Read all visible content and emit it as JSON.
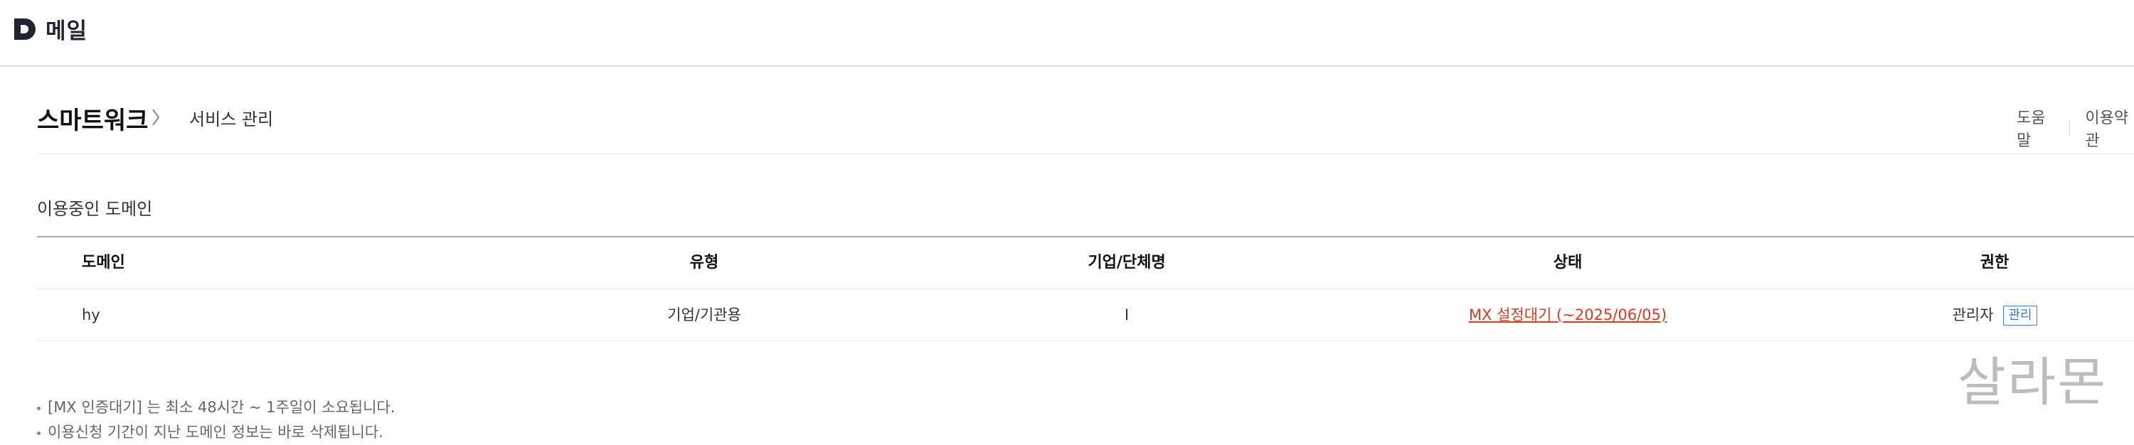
{
  "header": {
    "logo_text": "메일"
  },
  "breadcrumb": {
    "title": "스마트워크",
    "current": "서비스 관리"
  },
  "top_links": [
    "도움말",
    "이용약관"
  ],
  "section": {
    "title": "이용중인 도메인"
  },
  "table": {
    "columns": [
      "도메인",
      "유형",
      "기업/단체명",
      "상태",
      "권한"
    ],
    "rows": [
      {
        "domain": "hy",
        "type": "기업/기관용",
        "org": "I",
        "status": "MX 설정대기 (~2025/06/05)",
        "role": "관리자",
        "manage": "관리"
      }
    ]
  },
  "watermark": "살라몬",
  "notes": [
    "[MX 인증대기] 는 최소 48시간 ~ 1주일이 소요됩니다.",
    "이용신청 기간이 지난 도메인 정보는 바로 삭제됩니다."
  ],
  "colors": {
    "status": "#e03a1e",
    "manage_button": "#2f76d8",
    "logo": "#1f2533"
  }
}
